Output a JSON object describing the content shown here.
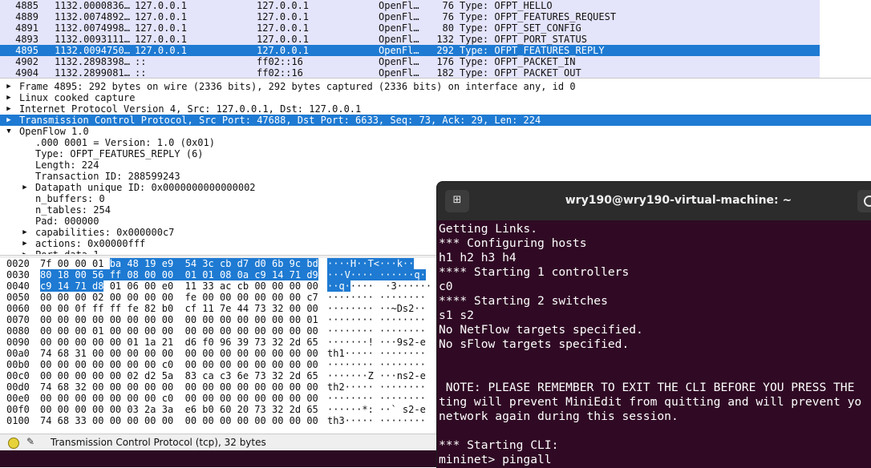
{
  "packets": [
    {
      "no": "4885",
      "time": "1132.0000836…",
      "src": "127.0.0.1",
      "dst": "127.0.0.1",
      "proto": "OpenFl…",
      "len": "76",
      "info": "Type: OFPT_HELLO",
      "selected": false
    },
    {
      "no": "4889",
      "time": "1132.0074892…",
      "src": "127.0.0.1",
      "dst": "127.0.0.1",
      "proto": "OpenFl…",
      "len": "76",
      "info": "Type: OFPT_FEATURES_REQUEST",
      "selected": false
    },
    {
      "no": "4891",
      "time": "1132.0074998…",
      "src": "127.0.0.1",
      "dst": "127.0.0.1",
      "proto": "OpenFl…",
      "len": "80",
      "info": "Type: OFPT_SET_CONFIG",
      "selected": false
    },
    {
      "no": "4893",
      "time": "1132.0093111…",
      "src": "127.0.0.1",
      "dst": "127.0.0.1",
      "proto": "OpenFl…",
      "len": "132",
      "info": "Type: OFPT_PORT_STATUS",
      "selected": false
    },
    {
      "no": "4895",
      "time": "1132.0094750…",
      "src": "127.0.0.1",
      "dst": "127.0.0.1",
      "proto": "OpenFl…",
      "len": "292",
      "info": "Type: OFPT_FEATURES_REPLY",
      "selected": true
    },
    {
      "no": "4902",
      "time": "1132.2898398…",
      "src": "::",
      "dst": "ff02::16",
      "proto": "OpenFl…",
      "len": "176",
      "info": "Type: OFPT_PACKET_IN",
      "selected": false
    },
    {
      "no": "4904",
      "time": "1132.2899081…",
      "src": "::",
      "dst": "ff02::16",
      "proto": "OpenFl…",
      "len": "182",
      "info": "Type: OFPT_PACKET_OUT",
      "selected": false
    }
  ],
  "details": [
    {
      "level": 0,
      "expander": "collapsed",
      "text": "Frame 4895: 292 bytes on wire (2336 bits), 292 bytes captured (2336 bits) on interface any, id 0",
      "selected": false
    },
    {
      "level": 0,
      "expander": "collapsed",
      "text": "Linux cooked capture",
      "selected": false
    },
    {
      "level": 0,
      "expander": "collapsed",
      "text": "Internet Protocol Version 4, Src: 127.0.0.1, Dst: 127.0.0.1",
      "selected": false
    },
    {
      "level": 0,
      "expander": "collapsed",
      "text": "Transmission Control Protocol, Src Port: 47688, Dst Port: 6633, Seq: 73, Ack: 29, Len: 224",
      "selected": true
    },
    {
      "level": 0,
      "expander": "expanded",
      "text": "OpenFlow 1.0",
      "selected": false
    },
    {
      "level": 1,
      "expander": "none",
      "text": ".000 0001 = Version: 1.0 (0x01)",
      "selected": false
    },
    {
      "level": 1,
      "expander": "none",
      "text": "Type: OFPT_FEATURES_REPLY (6)",
      "selected": false
    },
    {
      "level": 1,
      "expander": "none",
      "text": "Length: 224",
      "selected": false
    },
    {
      "level": 1,
      "expander": "none",
      "text": "Transaction ID: 288599243",
      "selected": false
    },
    {
      "level": 1,
      "expander": "collapsed",
      "text": "Datapath unique ID: 0x0000000000000002",
      "selected": false
    },
    {
      "level": 1,
      "expander": "none",
      "text": "n_buffers: 0",
      "selected": false
    },
    {
      "level": 1,
      "expander": "none",
      "text": "n_tables: 254",
      "selected": false
    },
    {
      "level": 1,
      "expander": "none",
      "text": "Pad: 000000",
      "selected": false
    },
    {
      "level": 1,
      "expander": "collapsed",
      "text": "capabilities: 0x000000c7",
      "selected": false
    },
    {
      "level": 1,
      "expander": "collapsed",
      "text": "actions: 0x00000fff",
      "selected": false
    },
    {
      "level": 1,
      "expander": "collapsed",
      "text": "Port data 1",
      "selected": false
    }
  ],
  "hex_rows": [
    {
      "offset": "0020",
      "pre": "7f 00 00 01 ",
      "hl": "ba 48 19 e9  54 3c cb d7 d0 6b 9c bd",
      "post": "",
      "asc_pre": "",
      "asc_hl": "····H··T<···k··",
      "asc_post": ""
    },
    {
      "offset": "0030",
      "pre": "",
      "hl": "80 18 00 56 ff 08 00 00  01 01 08 0a c9 14 71 d9",
      "post": "",
      "asc_pre": "",
      "asc_hl": "···V···· ······q·",
      "asc_post": ""
    },
    {
      "offset": "0040",
      "pre": "",
      "hl": "c9 14 71 d8",
      "post": " 01 06 00 e0  11 33 ac cb 00 00 00 00",
      "asc_pre": "",
      "asc_hl": "··q·",
      "asc_post": "····  ·3······"
    },
    {
      "offset": "0050",
      "pre": "00 00 00 02 00 00 00 00  fe 00 00 00 00 00 00 c7",
      "hl": "",
      "post": "",
      "asc_pre": "········ ········",
      "asc_hl": "",
      "asc_post": ""
    },
    {
      "offset": "0060",
      "pre": "00 00 0f ff ff fe 82 b0  cf 11 7e 44 73 32 00 00",
      "hl": "",
      "post": "",
      "asc_pre": "········ ··~Ds2··",
      "asc_hl": "",
      "asc_post": ""
    },
    {
      "offset": "0070",
      "pre": "00 00 00 00 00 00 00 00  00 00 00 00 00 00 00 01",
      "hl": "",
      "post": "",
      "asc_pre": "········ ········",
      "asc_hl": "",
      "asc_post": ""
    },
    {
      "offset": "0080",
      "pre": "00 00 00 01 00 00 00 00  00 00 00 00 00 00 00 00",
      "hl": "",
      "post": "",
      "asc_pre": "········ ········",
      "asc_hl": "",
      "asc_post": ""
    },
    {
      "offset": "0090",
      "pre": "00 00 00 00 00 01 1a 21  d6 f0 96 39 73 32 2d 65",
      "hl": "",
      "post": "",
      "asc_pre": "·······! ···9s2-e",
      "asc_hl": "",
      "asc_post": ""
    },
    {
      "offset": "00a0",
      "pre": "74 68 31 00 00 00 00 00  00 00 00 00 00 00 00 00",
      "hl": "",
      "post": "",
      "asc_pre": "th1····· ········",
      "asc_hl": "",
      "asc_post": ""
    },
    {
      "offset": "00b0",
      "pre": "00 00 00 00 00 00 00 c0  00 00 00 00 00 00 00 00",
      "hl": "",
      "post": "",
      "asc_pre": "········ ········",
      "asc_hl": "",
      "asc_post": ""
    },
    {
      "offset": "00c0",
      "pre": "00 00 00 00 00 02 d2 5a  83 ca c3 6e 73 32 2d 65",
      "hl": "",
      "post": "",
      "asc_pre": "·······Z ···ns2-e",
      "asc_hl": "",
      "asc_post": ""
    },
    {
      "offset": "00d0",
      "pre": "74 68 32 00 00 00 00 00  00 00 00 00 00 00 00 00",
      "hl": "",
      "post": "",
      "asc_pre": "th2····· ········",
      "asc_hl": "",
      "asc_post": ""
    },
    {
      "offset": "00e0",
      "pre": "00 00 00 00 00 00 00 c0  00 00 00 00 00 00 00 00",
      "hl": "",
      "post": "",
      "asc_pre": "········ ········",
      "asc_hl": "",
      "asc_post": ""
    },
    {
      "offset": "00f0",
      "pre": "00 00 00 00 00 03 2a 3a  e6 b0 60 20 73 32 2d 65",
      "hl": "",
      "post": "",
      "asc_pre": "······*: ··` s2-e",
      "asc_hl": "",
      "asc_post": ""
    },
    {
      "offset": "0100",
      "pre": "74 68 33 00 00 00 00 00  00 00 00 00 00 00 00 00",
      "hl": "",
      "post": "",
      "asc_pre": "th3····· ········",
      "asc_hl": "",
      "asc_post": ""
    }
  ],
  "status": {
    "text": "Transmission Control Protocol (tcp), 32 bytes",
    "led_icon": "expert-info-led-icon",
    "edit_icon": "edit-comment-icon"
  },
  "terminal": {
    "title": "wry190@wry190-virtual-machine: ~",
    "newtab_icon": "new-tab-icon",
    "search_icon": "search-icon",
    "lines": [
      "Getting Links.",
      "*** Configuring hosts",
      "h1 h2 h3 h4",
      "**** Starting 1 controllers",
      "c0",
      "**** Starting 2 switches",
      "s1 s2",
      "No NetFlow targets specified.",
      "No sFlow targets specified.",
      "",
      "",
      " NOTE: PLEASE REMEMBER TO EXIT THE CLI BEFORE YOU PRESS THE",
      "ting will prevent MiniEdit from quitting and will prevent yo",
      "network again during this session.",
      "",
      "*** Starting CLI:",
      "mininet> pingall"
    ]
  },
  "colors": {
    "selection": "#1e7ad2",
    "packet_row_bg": "#e4e4fb",
    "terminal_bg": "#300a24",
    "terminal_header": "#2c2c2c"
  }
}
